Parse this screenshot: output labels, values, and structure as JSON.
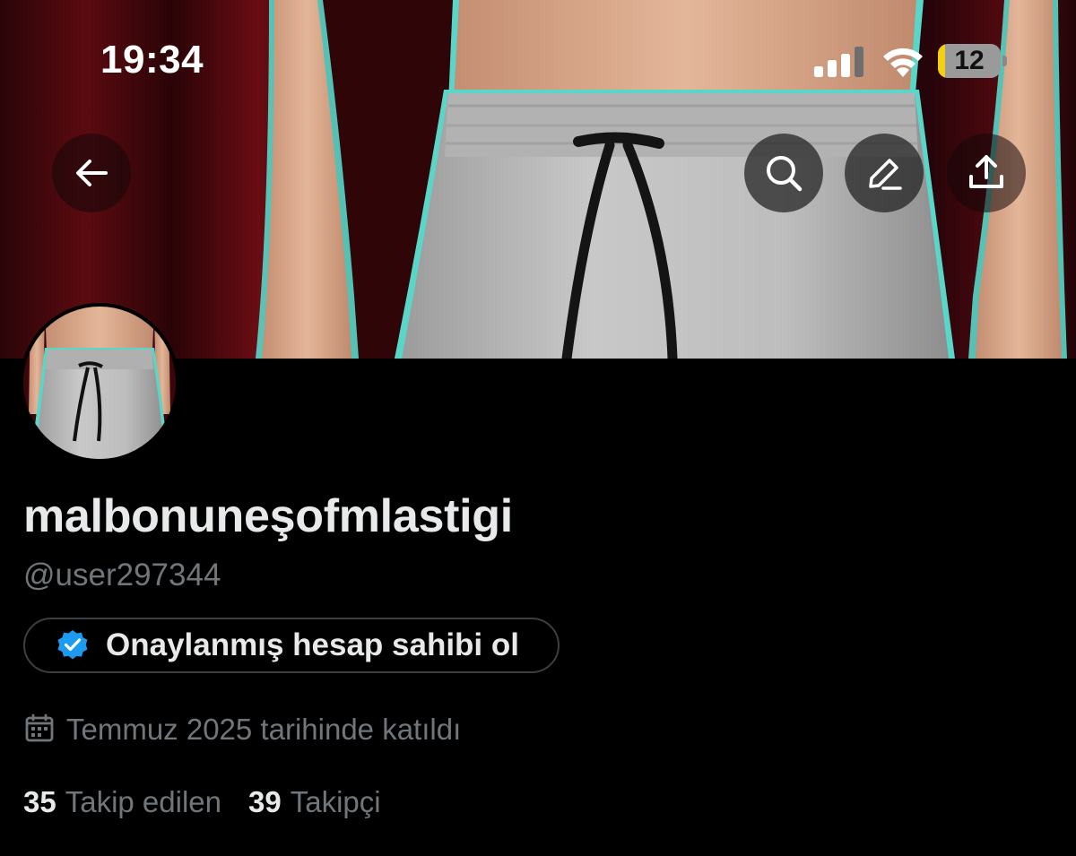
{
  "status_bar": {
    "time": "19:34",
    "battery_level": "12",
    "battery_fraction": 0.12,
    "signal_icon": "cellular-signal-icon",
    "wifi_icon": "wifi-icon",
    "battery_icon": "battery-icon"
  },
  "nav": {
    "back_icon": "arrow-left-icon",
    "search_icon": "search-icon",
    "edit_icon": "pencil-icon",
    "share_icon": "share-upload-icon"
  },
  "profile": {
    "display_name": "malbonuneşofmlastigi",
    "handle": "@user297344",
    "verify_cta": "Onaylanmış hesap sahibi ol",
    "verify_icon": "verified-badge-icon",
    "joined_icon": "calendar-icon",
    "joined_text": "Temmuz 2025 tarihinde katıldı",
    "following_count": "35",
    "following_label": "Takip edilen",
    "followers_count": "39",
    "followers_label": "Takipçi"
  },
  "colors": {
    "background": "#000000",
    "primary_text": "#e7e9ea",
    "secondary_text": "#71767b",
    "verified_blue": "#1d9bf0",
    "pill_border": "#3a3f44",
    "battery_yellow": "#f2cf13"
  }
}
